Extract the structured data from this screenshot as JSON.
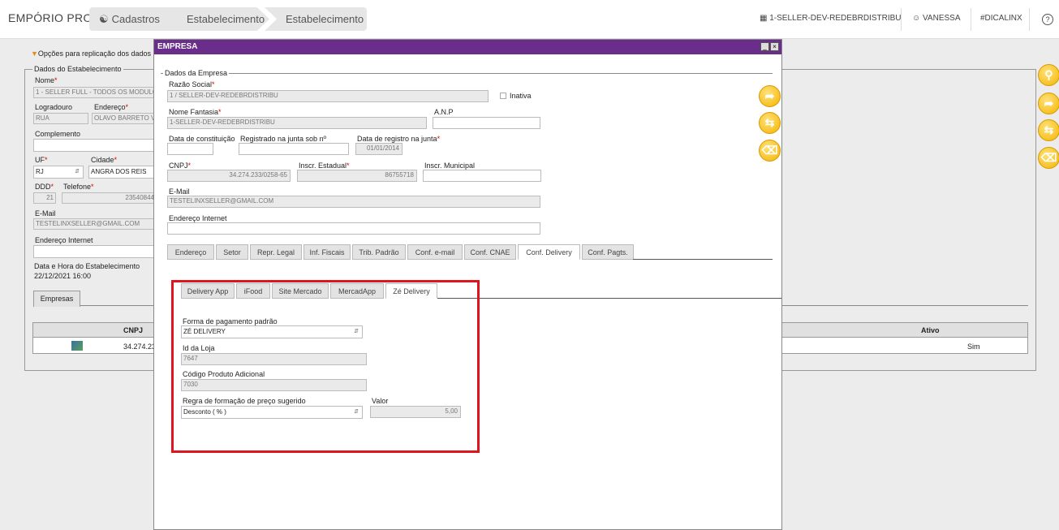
{
  "topbar": {
    "app_title": "EMPÓRIO PRO",
    "breadcrumbs": [
      "Cadastros",
      "Estabelecimento",
      "Estabelecimento"
    ],
    "store": "1-SELLER-DEV-REDEBRDISTRIBU",
    "user": "VANESSA",
    "hashtag": "#DICALINX",
    "help": "?"
  },
  "background": {
    "replication_link": "Opções para replicação dos dados",
    "fieldset_title": "Dados do Estabelecimento",
    "nome_label": "Nome",
    "nome_value": "1 - SELLER FULL - TODOS OS MODULOS",
    "logradouro_label": "Logradouro",
    "logradouro_value": "RUA",
    "endereco_label": "Endereço",
    "endereco_value": "OLAVO BARRETO VIANA",
    "complemento_label": "Complemento",
    "uf_label": "UF",
    "uf_value": "RJ",
    "cidade_label": "Cidade",
    "cidade_value": "ANGRA DOS REIS",
    "ddd_label": "DDD",
    "ddd_value": "21",
    "telefone_label": "Telefone",
    "telefone_value": "23540844",
    "email_label": "E-Mail",
    "email_value": "TESTELINXSELLER@GMAIL.COM",
    "endereco_internet_label": "Endereço Internet",
    "data_hora_label": "Data e Hora do Estabelecimento",
    "data_hora_value": "22/12/2021 16:00",
    "empresas_tab": "Empresas",
    "table_col_cnpj": "CNPJ",
    "table_col_ativo": "Ativo",
    "row_cnpj": "34.274.23",
    "row_ativo": "Sim"
  },
  "modal": {
    "title": "EMPRESA",
    "fieldset_title": "Dados da Empresa",
    "razao_label": "Razão Social",
    "razao_value": "1 / SELLER-DEV-REDEBRDISTRIBU",
    "inativa_label": "Inativa",
    "fantasia_label": "Nome Fantasia",
    "fantasia_value": "1-SELLER-DEV-REDEBRDISTRIBU",
    "anp_label": "A.N.P",
    "constituicao_label": "Data de constituição",
    "junta_label": "Registrado na junta sob nº",
    "registro_label": "Data de registro na junta",
    "registro_value": "01/01/2014",
    "cnpj_label": "CNPJ",
    "cnpj_value": "34.274.233/0258-65",
    "estadual_label": "Inscr. Estadual",
    "estadual_value": "86755718",
    "municipal_label": "Inscr. Municipal",
    "email_label": "E-Mail",
    "email_value": "TESTELINXSELLER@GMAIL.COM",
    "internet_label": "Endereço Internet",
    "tabs": [
      "Endereço",
      "Setor",
      "Repr. Legal",
      "Inf. Fiscais",
      "Trib. Padrão",
      "Conf. e-mail",
      "Conf. CNAE",
      "Conf. Delivery",
      "Conf. Pagts."
    ],
    "subtabs": [
      "Delivery App",
      "iFood",
      "Site Mercado",
      "MercadApp",
      "Zé Delivery"
    ],
    "forma_label": "Forma de pagamento padrão",
    "forma_value": "ZÉ DELIVERY",
    "idloja_label": "Id da Loja",
    "idloja_value": "7647",
    "codigo_label": "Código Produto Adicional",
    "codigo_value": "7030",
    "regra_label": "Regra de formação de preço sugerido",
    "regra_value": "Desconto ( % )",
    "valor_label": "Valor",
    "valor_value": "5,00",
    "required_mark": "*"
  },
  "colors": {
    "accent": "#6a2d8c",
    "highlight": "#e0141e",
    "button": "#f4b400"
  }
}
